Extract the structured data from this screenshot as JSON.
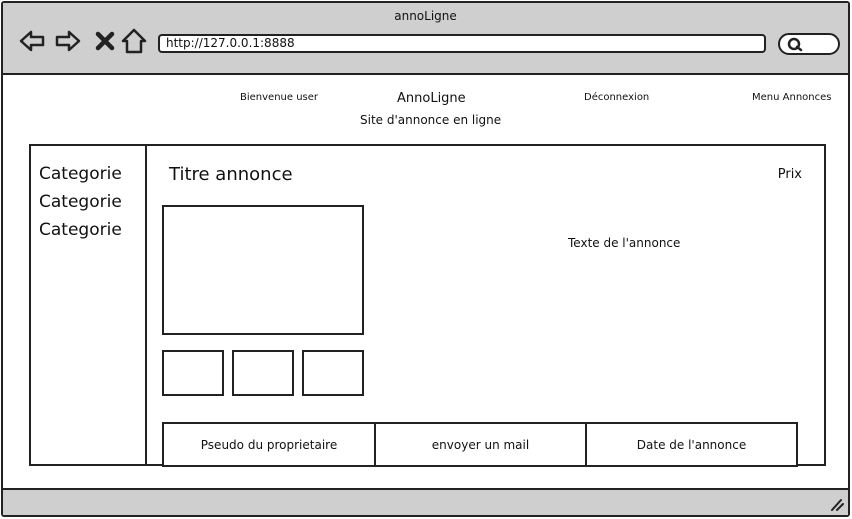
{
  "window": {
    "title": "annoLigne"
  },
  "toolbar": {
    "back_icon": "back-arrow-icon",
    "forward_icon": "forward-arrow-icon",
    "stop_icon": "close-icon",
    "home_icon": "home-icon",
    "url": "http://127.0.0.1:8888",
    "search_icon": "search-icon"
  },
  "header": {
    "welcome": "Bienvenue user",
    "brand": "AnnoLigne",
    "tagline": "Site d'annonce en ligne",
    "logout": "Déconnexion",
    "menu": "Menu Annonces"
  },
  "sidebar": {
    "items": [
      {
        "label": "Categorie"
      },
      {
        "label": "Categorie"
      },
      {
        "label": "Categorie"
      }
    ]
  },
  "ad": {
    "title": "Titre annonce",
    "price": "Prix",
    "text": "Texte de l'annonce",
    "owner": "Pseudo du proprietaire",
    "mail": "envoyer un mail",
    "date": "Date de l'annonce"
  },
  "colors": {
    "chrome": "#cfcfcf",
    "stroke": "#222222",
    "background": "#ffffff"
  }
}
